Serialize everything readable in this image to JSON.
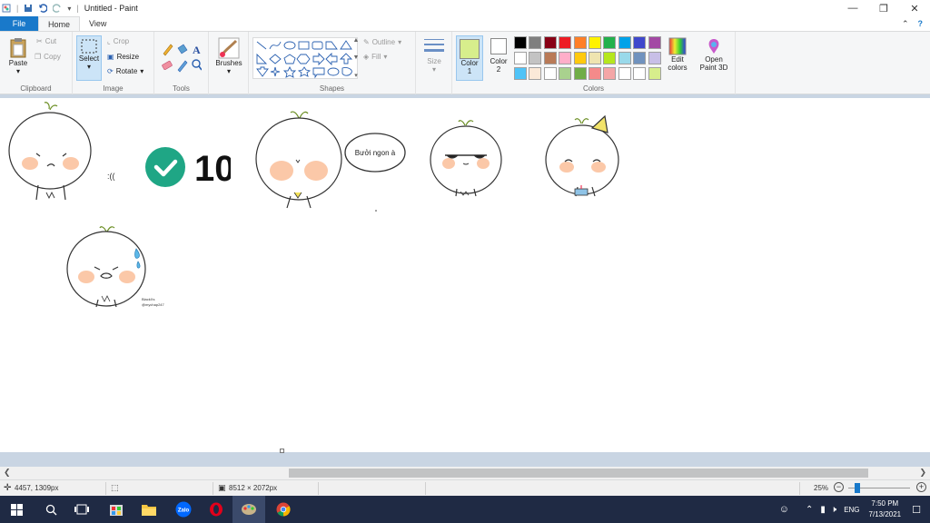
{
  "window": {
    "title": "Untitled - Paint",
    "controls": [
      "minimize",
      "maximize",
      "close"
    ]
  },
  "tabs": [
    {
      "label": "File"
    },
    {
      "label": "Home"
    },
    {
      "label": "View"
    }
  ],
  "ribbon": {
    "clipboard": {
      "group_label": "Clipboard",
      "paste": "Paste",
      "cut": "Cut",
      "copy": "Copy"
    },
    "image": {
      "group_label": "Image",
      "select": "Select",
      "crop": "Crop",
      "resize": "Resize",
      "rotate": "Rotate"
    },
    "tools": {
      "group_label": "Tools"
    },
    "brushes": {
      "label": "Brushes"
    },
    "shapes": {
      "group_label": "Shapes",
      "outline": "Outline",
      "fill": "Fill"
    },
    "size": {
      "label": "Size"
    },
    "colors": {
      "group_label": "Colors",
      "color1": "Color",
      "color1_num": "1",
      "color2": "Color",
      "color2_num": "2",
      "edit": "Edit",
      "edit2": "colors",
      "open": "Open",
      "open2": "Paint 3D",
      "color1_value": "#d7ee8c",
      "color2_value": "#ffffff",
      "palette_row1": [
        "#000000",
        "#7f7f7f",
        "#880015",
        "#ed1c24",
        "#ff7f27",
        "#fff200",
        "#22b14c",
        "#00a2e8",
        "#3f48cc",
        "#a349a4"
      ],
      "palette_row2": [
        "#ffffff",
        "#c3c3c3",
        "#b97a57",
        "#ffaec9",
        "#ffc90e",
        "#efe4b0",
        "#b5e61d",
        "#99d9ea",
        "#7092be",
        "#c8bfe7"
      ],
      "palette_row3": [
        "#4fc3f7",
        "#fbe9d8",
        "#ffffff",
        "#a9d18e",
        "#70ad47",
        "#f48a8a",
        "#f4a6a6",
        "#ffffff",
        "#ffffff",
        "#d7ee8c"
      ]
    }
  },
  "canvas": {
    "speech_text": "Bưởi ngon à",
    "big_text": "10",
    "emote_text": ":((",
    "sign1": "BlackXs",
    "sign2": "@mychap247"
  },
  "statusbar": {
    "cursor_pos": "4457, 1309px",
    "dimensions": "8512 × 2072px",
    "zoom": "25%"
  },
  "taskbar": {
    "lang": "ENG",
    "time": "7:50 PM",
    "date": "7/13/2021"
  }
}
